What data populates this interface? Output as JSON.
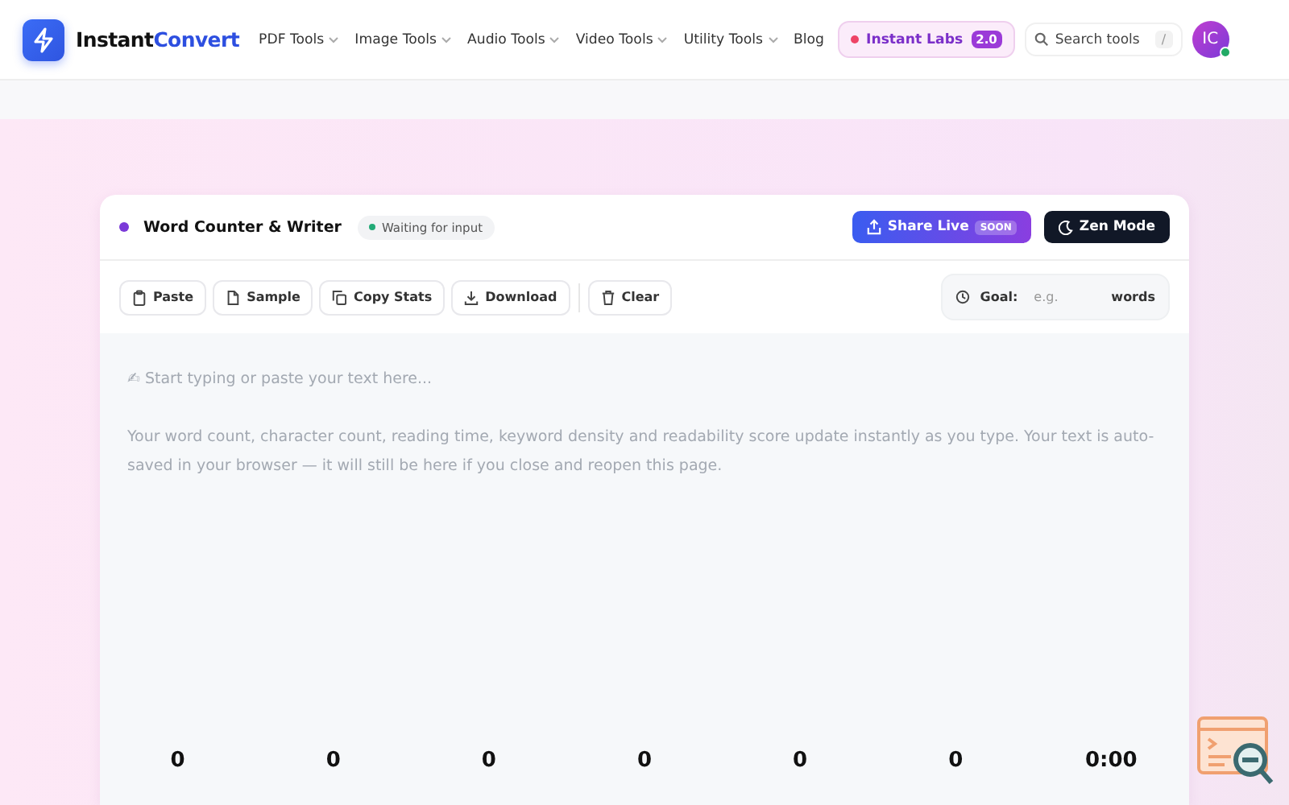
{
  "brand": {
    "name_first": "Instant",
    "name_second": "Convert"
  },
  "nav": [
    {
      "label": "PDF Tools",
      "dropdown": true
    },
    {
      "label": "Image Tools",
      "dropdown": true
    },
    {
      "label": "Audio Tools",
      "dropdown": true
    },
    {
      "label": "Video Tools",
      "dropdown": true
    },
    {
      "label": "Utility Tools",
      "dropdown": true
    },
    {
      "label": "Blog",
      "dropdown": false
    }
  ],
  "labs": {
    "label": "Instant Labs",
    "badge": "2.0"
  },
  "search": {
    "placeholder": "Search tools",
    "shortcut": "/"
  },
  "avatar": {
    "initials": "IC",
    "online": true
  },
  "tool": {
    "title": "Word Counter & Writer",
    "status": "Waiting for input",
    "share": {
      "label": "Share Live",
      "badge": "SOON"
    },
    "zen": "Zen Mode"
  },
  "toolbar": [
    {
      "label": "Paste",
      "kind": "clipboard"
    },
    {
      "label": "Sample",
      "kind": "file"
    },
    {
      "label": "Copy Stats",
      "kind": "copy"
    },
    {
      "label": "Download",
      "kind": "download"
    },
    {
      "label": "Clear",
      "kind": "trash"
    }
  ],
  "goal": {
    "label": "Goal:",
    "placeholder": "e.g.",
    "unit": "words"
  },
  "editor": {
    "placeholder": "✍ Start typing or paste your text here...\n\nYour word count, character count, reading time, keyword density and readability score update instantly as you type. Your text is auto-saved in your browser — it will still be here if you close and reopen this page."
  },
  "stats": [
    "0",
    "0",
    "0",
    "0",
    "0",
    "0",
    "0:00"
  ]
}
